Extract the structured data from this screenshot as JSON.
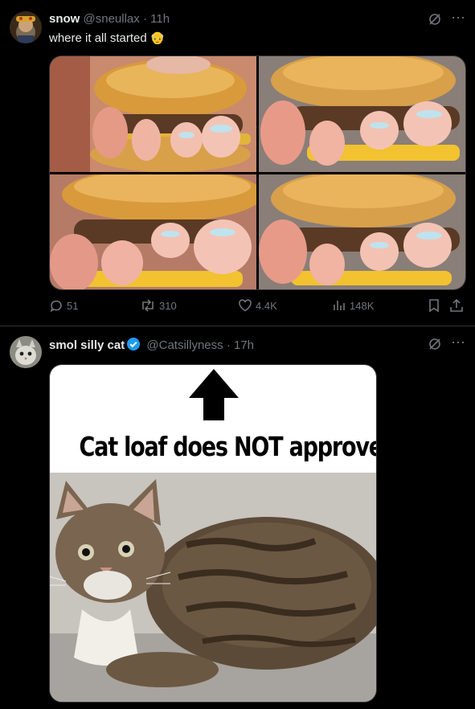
{
  "posts": [
    {
      "author_name": "snow",
      "author_handle": "@sneullax",
      "separator": "·",
      "time": "11h",
      "text": "where it all started",
      "emoji": "👴",
      "media_description": "four-photo grid",
      "stats": {
        "replies": "51",
        "reposts": "310",
        "likes": "4.4K",
        "views": "148K"
      }
    },
    {
      "author_name": "smol silly cat",
      "verified": true,
      "author_handle": "@Catsillyness",
      "separator": "·",
      "time": "17h",
      "meme_caption": "Cat loaf does NOT approve"
    }
  ],
  "colors": {
    "background": "#000000",
    "text_primary": "#e7e9ea",
    "text_secondary": "#71767b",
    "divider": "#2f3336",
    "verified_blue": "#1d9bf0"
  },
  "icons": [
    "grok-icon",
    "more-icon",
    "reply-icon",
    "repost-icon",
    "like-icon",
    "views-icon",
    "bookmark-icon",
    "share-icon",
    "verified-icon",
    "arrow-up-icon"
  ]
}
